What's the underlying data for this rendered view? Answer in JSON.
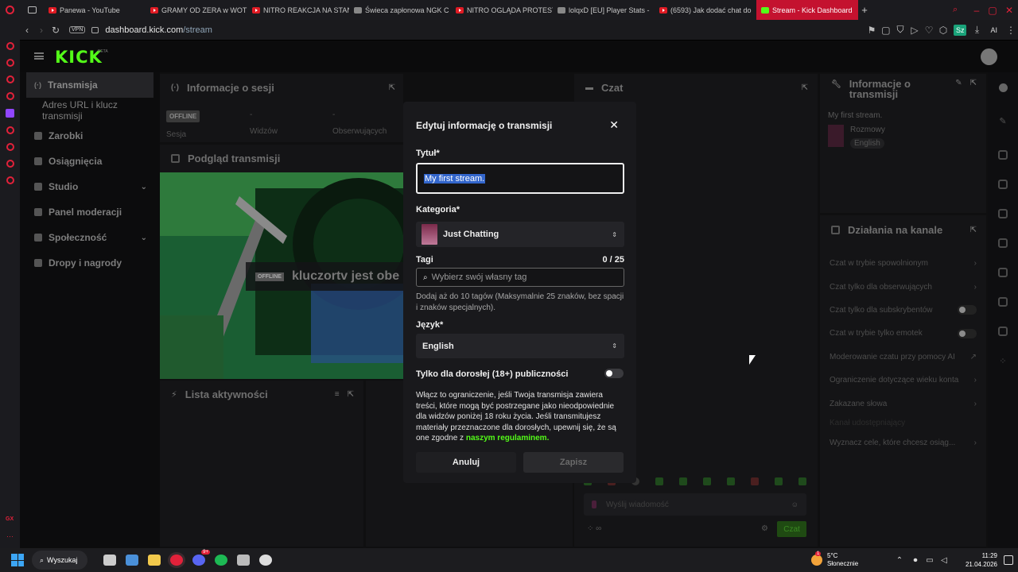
{
  "browser": {
    "tabs": [
      {
        "label": "Panewa - YouTube",
        "favicon": "youtube"
      },
      {
        "label": "GRAMY OD ZERA w WOT",
        "favicon": "youtube"
      },
      {
        "label": "NITRO REAKCJA NA STAN",
        "favicon": "youtube"
      },
      {
        "label": "Świeca zapłonowa NGK C",
        "favicon": "generic"
      },
      {
        "label": "NITRO OGLĄDA PROTEST",
        "favicon": "youtube"
      },
      {
        "label": "lolqxD [EU] Player Stats -",
        "favicon": "generic"
      },
      {
        "label": "(6593) Jak dodać chat do",
        "favicon": "youtube"
      },
      {
        "label": "Stream - Kick Dashboard",
        "favicon": "kick"
      }
    ],
    "vpn_badge": "VPN",
    "url_domain": "dashboard.kick.com",
    "url_path": "/stream",
    "ai_label": "AI",
    "profile_badge": "Sz"
  },
  "kick": {
    "logo": "KICK",
    "logo_beta": "BETA",
    "nav": [
      {
        "label": "Transmisja",
        "active": true
      },
      {
        "label": "Adres URL i klucz transmisji",
        "sub": true
      },
      {
        "label": "Zarobki"
      },
      {
        "label": "Osiągnięcia"
      },
      {
        "label": "Studio",
        "chevron": true
      },
      {
        "label": "Panel moderacji"
      },
      {
        "label": "Społeczność",
        "chevron": true
      },
      {
        "label": "Dropy i nagrody"
      }
    ],
    "session_panel": {
      "title": "Informacje o sesji",
      "status_badge": "OFFLINE",
      "stats": [
        {
          "value": "",
          "label": "Sesja"
        },
        {
          "value": "-",
          "label": "Widzów"
        },
        {
          "value": "-",
          "label": "Obserwujących"
        }
      ]
    },
    "preview_panel": {
      "title": "Podgląd transmisji",
      "offline_badge": "OFFLINE",
      "offline_text": "kluczortv jest obe"
    },
    "activity_panel": {
      "title": "Lista aktywności"
    },
    "chat_panel": {
      "title": "Czat",
      "input_placeholder": "Wyślij wiadomość",
      "send_label": "Czat"
    },
    "stream_info_panel": {
      "title": "Informacje o transmisji",
      "stream_title": "My first stream.",
      "category": "Rozmowy",
      "language": "English"
    },
    "channel_actions": {
      "title": "Działania na kanale",
      "items": [
        {
          "label": "Czat w trybie spowolnionym",
          "control": "chevron"
        },
        {
          "label": "Czat tylko dla obserwujących",
          "control": "chevron"
        },
        {
          "label": "Czat tylko dla subskrybentów",
          "control": "toggle"
        },
        {
          "label": "Czat w trybie tylko emotek",
          "control": "toggle"
        },
        {
          "label": "Moderowanie czatu przy pomocy AI",
          "control": "external"
        },
        {
          "label": "Ograniczenie dotyczące wieku konta",
          "control": "chevron"
        },
        {
          "label": "Zakazane słowa",
          "control": "chevron"
        },
        {
          "label": "Kanał udostępniający",
          "control": "none"
        },
        {
          "label": "Wyznacz cele, które chcesz osiąg...",
          "control": "chevron"
        }
      ]
    }
  },
  "modal": {
    "title": "Edytuj informację o transmisji",
    "title_label": "Tytuł*",
    "title_value": "My first stream.",
    "category_label": "Kategoria*",
    "category_value": "Just Chatting",
    "tags_label": "Tagi",
    "tags_count": "0 / 25",
    "tags_placeholder": "Wybierz swój własny tag",
    "tags_helper": "Dodaj aż do 10 tagów (Maksymalnie 25 znaków, bez spacji i znaków specjalnych).",
    "language_label": "Język*",
    "language_value": "English",
    "adult_label": "Tylko dla dorosłej (18+) publiczności",
    "adult_enabled": false,
    "adult_helper_text": "Włącz to ograniczenie, jeśli Twoja transmisja zawiera treści, które mogą być postrzegane jako nieodpowiednie dla widzów poniżej 18 roku życia. Jeśli transmitujesz materiały przeznaczone dla dorosłych, upewnij się, że są one zgodne z",
    "adult_helper_link": "naszym regulaminem",
    "adult_helper_end": ".",
    "cancel_label": "Anuluj",
    "save_label": "Zapisz"
  },
  "taskbar": {
    "search_label": "Wyszukaj",
    "discord_badge": "9+",
    "weather_badge": "1",
    "weather_temp": "5°C",
    "weather_desc": "Słonecznie",
    "time": "11:29",
    "date": "21.04.2026"
  },
  "colors": {
    "accent": "#53fc18",
    "tab_active": "#c4122f",
    "modal_bg": "#19191c",
    "field_bg": "#242428",
    "link": "#53fc18"
  }
}
